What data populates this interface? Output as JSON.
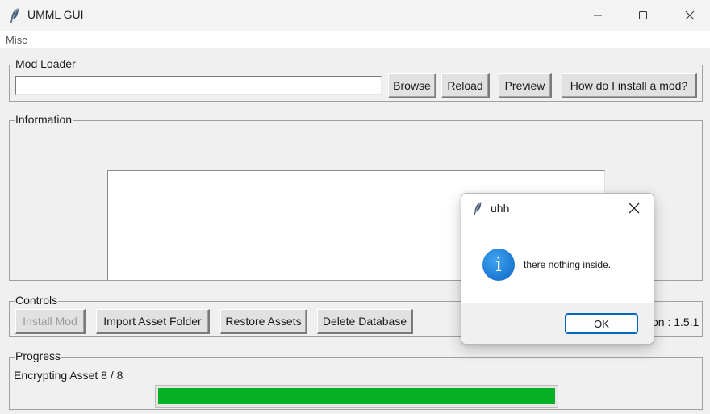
{
  "window": {
    "title": "UMML GUI",
    "app_icon": "feather-icon",
    "controls": [
      "minimize-icon",
      "maximize-icon",
      "close-icon"
    ]
  },
  "menu": {
    "items": [
      {
        "label": "Misc"
      }
    ]
  },
  "mod_loader": {
    "group_label": "Mod Loader",
    "path_value": "",
    "buttons": {
      "browse": "Browse",
      "reload": "Reload",
      "preview": "Preview",
      "how_to": "How do I install a mod?"
    }
  },
  "information": {
    "group_label": "Information",
    "text": ""
  },
  "controls": {
    "group_label": "Controls",
    "buttons": {
      "install_mod": "Install Mod",
      "import_asset_folder": "Import Asset Folder",
      "restore_assets": "Restore Assets",
      "delete_database": "Delete Database"
    },
    "version_text": "on : 1.5.1"
  },
  "progress": {
    "group_label": "Progress",
    "status": "Encrypting Asset 8 / 8",
    "value_percent": 100,
    "bar_color": "#06b025"
  },
  "dialog": {
    "title": "uhh",
    "icon": "info-icon",
    "icon_glyph": "i",
    "message": "there nothing inside.",
    "ok_label": "OK",
    "accent_color": "#0067c0"
  }
}
